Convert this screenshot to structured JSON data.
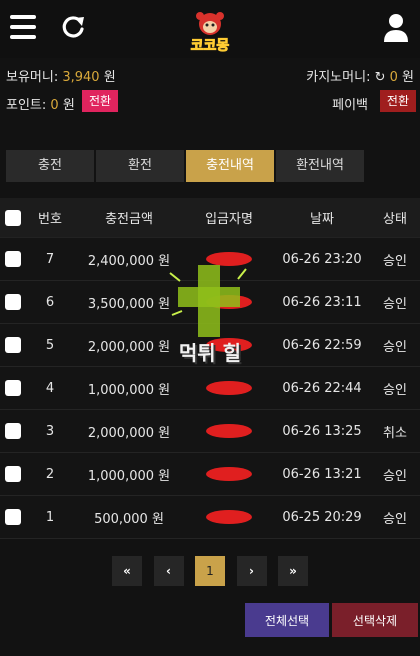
{
  "header": {
    "logo_text": "코코몽",
    "icons": [
      "hamburger-menu-icon",
      "refresh-icon",
      "user-icon"
    ]
  },
  "balance": {
    "cash_label": "보유머니: ",
    "cash_value": "3,940",
    "cash_unit": " 원",
    "casino_label": "카지노머니: ",
    "casino_value": "0",
    "casino_unit": " 원",
    "point_label": "포인트: ",
    "point_value": "0",
    "point_unit": " 원",
    "point_convert": "전환",
    "payback_label": "페이백",
    "payback_convert": "전환"
  },
  "tabs": [
    {
      "label": "충전",
      "active": false
    },
    {
      "label": "환전",
      "active": false
    },
    {
      "label": "충전내역",
      "active": true
    },
    {
      "label": "환전내역",
      "active": false
    }
  ],
  "table": {
    "headers": {
      "no": "번호",
      "amount": "충전금액",
      "depositor": "입금자명",
      "date": "날짜",
      "status": "상태"
    },
    "rows": [
      {
        "no": "7",
        "amount": "2,400,000 원",
        "date": "06-26 23:20",
        "status": "승인"
      },
      {
        "no": "6",
        "amount": "3,500,000 원",
        "date": "06-26 23:11",
        "status": "승인"
      },
      {
        "no": "5",
        "amount": "2,000,000 원",
        "date": "06-26 22:59",
        "status": "승인"
      },
      {
        "no": "4",
        "amount": "1,000,000 원",
        "date": "06-26 22:44",
        "status": "승인"
      },
      {
        "no": "3",
        "amount": "2,000,000 원",
        "date": "06-26 13:25",
        "status": "취소"
      },
      {
        "no": "2",
        "amount": "1,000,000 원",
        "date": "06-26 13:21",
        "status": "승인"
      },
      {
        "no": "1",
        "amount": "500,000 원",
        "date": "06-25 20:29",
        "status": "승인"
      }
    ]
  },
  "pagination": {
    "first": "«",
    "prev": "‹",
    "current": "1",
    "next": "›",
    "last": "»"
  },
  "actions": {
    "select_all": "전체선택",
    "delete_selected": "선택삭제"
  },
  "watermark": {
    "text": "먹튀 힐"
  },
  "colors": {
    "accent_gold": "#c9a24a",
    "pink": "#e0245e",
    "red": "#a01e1e",
    "purple": "#4a3b8f"
  }
}
